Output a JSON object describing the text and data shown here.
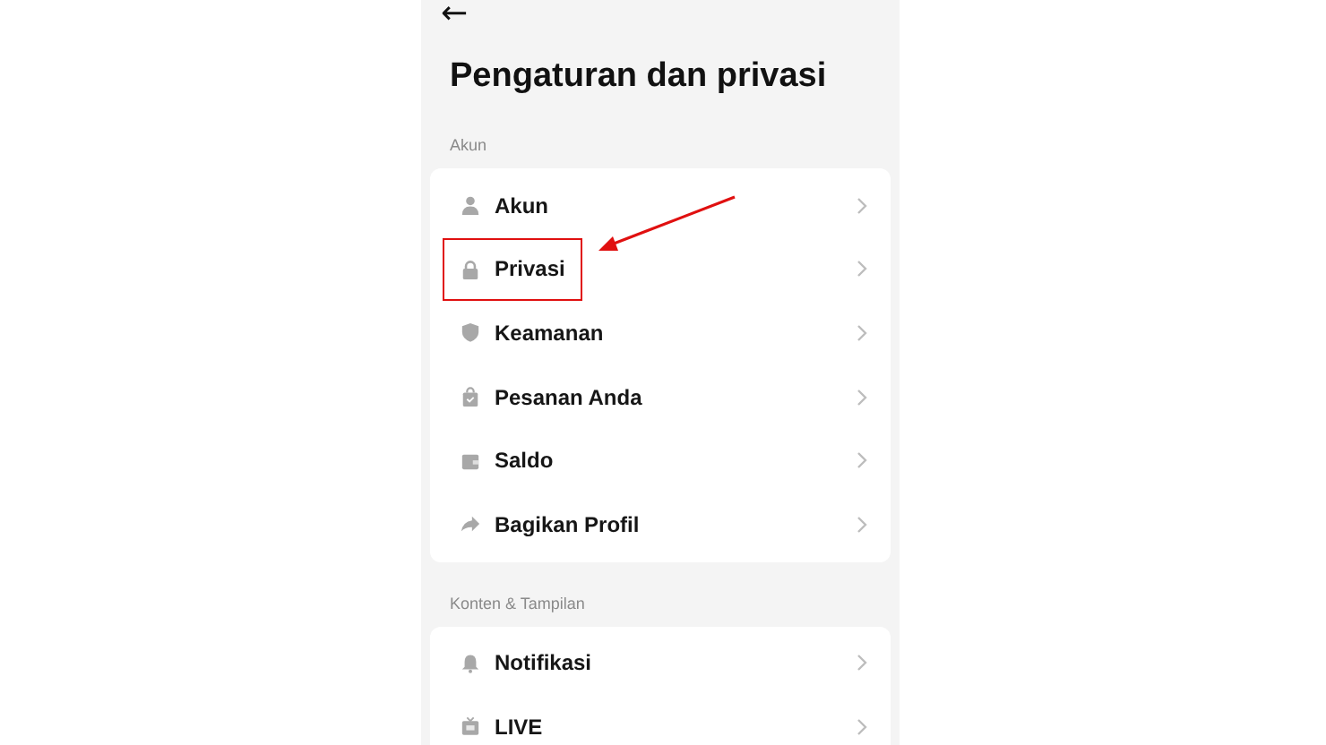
{
  "back_button": {
    "label": "←"
  },
  "title": "Pengaturan dan privasi",
  "sections": [
    {
      "heading": "Akun",
      "items": [
        {
          "kind": "account",
          "label": "Akun",
          "highlighted": false
        },
        {
          "kind": "privacy",
          "label": "Privasi",
          "highlighted": true
        },
        {
          "kind": "security",
          "label": "Keamanan",
          "highlighted": false
        },
        {
          "kind": "orders",
          "label": "Pesanan Anda",
          "highlighted": false
        },
        {
          "kind": "balance",
          "label": "Saldo",
          "highlighted": false
        },
        {
          "kind": "share",
          "label": "Bagikan Profil",
          "highlighted": false
        }
      ]
    },
    {
      "heading": "Konten & Tampilan",
      "items": [
        {
          "kind": "notifications",
          "label": "Notifikasi",
          "highlighted": false
        },
        {
          "kind": "live",
          "label": "LIVE",
          "highlighted": false
        }
      ]
    }
  ]
}
